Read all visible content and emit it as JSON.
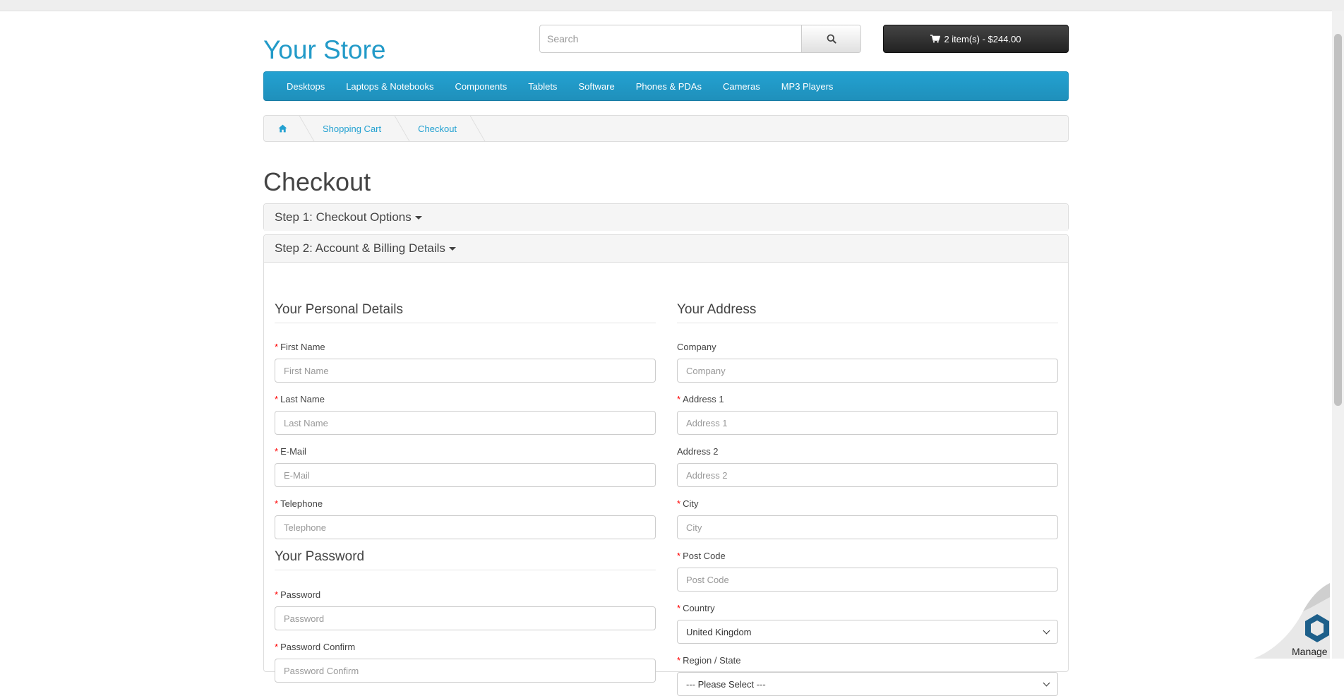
{
  "store": {
    "name": "Your Store"
  },
  "search": {
    "placeholder": "Search"
  },
  "cart": {
    "label": "2 item(s) - $244.00"
  },
  "menu": [
    "Desktops",
    "Laptops & Notebooks",
    "Components",
    "Tablets",
    "Software",
    "Phones & PDAs",
    "Cameras",
    "MP3 Players"
  ],
  "breadcrumb": {
    "items": [
      "Shopping Cart",
      "Checkout"
    ]
  },
  "page": {
    "title": "Checkout"
  },
  "steps": {
    "step1": "Step 1: Checkout Options",
    "step2": "Step 2: Account & Billing Details"
  },
  "personal": {
    "legend": "Your Personal Details",
    "fields": [
      {
        "label": "First Name",
        "placeholder": "First Name",
        "required": true
      },
      {
        "label": "Last Name",
        "placeholder": "Last Name",
        "required": true
      },
      {
        "label": "E-Mail",
        "placeholder": "E-Mail",
        "required": true
      },
      {
        "label": "Telephone",
        "placeholder": "Telephone",
        "required": true
      }
    ]
  },
  "password": {
    "legend": "Your Password",
    "fields": [
      {
        "label": "Password",
        "placeholder": "Password",
        "required": true
      },
      {
        "label": "Password Confirm",
        "placeholder": "Password Confirm",
        "required": true
      }
    ]
  },
  "address": {
    "legend": "Your Address",
    "fields": [
      {
        "label": "Company",
        "placeholder": "Company",
        "required": false
      },
      {
        "label": "Address 1",
        "placeholder": "Address 1",
        "required": true
      },
      {
        "label": "Address 2",
        "placeholder": "Address 2",
        "required": false
      },
      {
        "label": "City",
        "placeholder": "City",
        "required": true
      },
      {
        "label": "Post Code",
        "placeholder": "Post Code",
        "required": true
      }
    ],
    "country": {
      "label": "Country",
      "value": "United Kingdom",
      "required": true
    },
    "region": {
      "label": "Region / State",
      "value": "--- Please Select ---",
      "required": true
    }
  },
  "widget": {
    "label": "Manage"
  },
  "colors": {
    "accent": "#229ac8",
    "required": "#ff0000",
    "cart_bg": "#222222"
  }
}
